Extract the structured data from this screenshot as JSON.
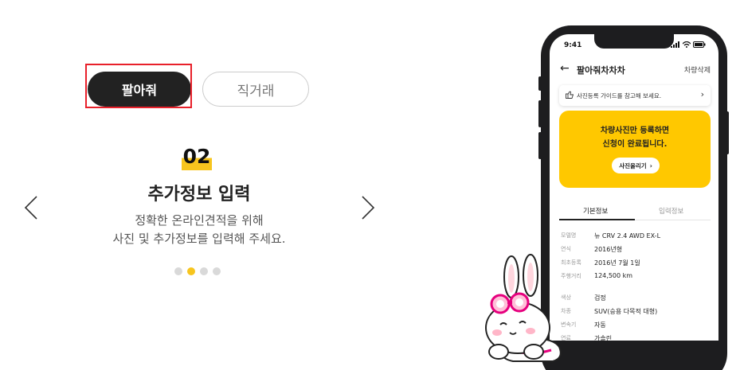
{
  "tabs": {
    "sell_label": "팔아줘",
    "direct_label": "직거래"
  },
  "step": {
    "number": "02",
    "title": "추가정보 입력",
    "desc_line1": "정확한 온라인견적을 위해",
    "desc_line2": "사진 및 추가정보를 입력해 주세요."
  },
  "pagination": {
    "total": 4,
    "active_index": 1
  },
  "colors": {
    "accent": "#ffc800",
    "highlight_border": "#e8202a",
    "dark": "#222222"
  },
  "phone": {
    "time": "9:41",
    "header_title": "팔아줘차차차",
    "header_action": "차량삭제",
    "guide_text": "사진등록 가이드를 참고해 보세요.",
    "card_line1": "차량사진만 등록하면",
    "card_line2": "신청이 완료됩니다.",
    "upload_button": "사진올리기",
    "tab_basic": "기본정보",
    "tab_input": "입력정보",
    "rows": [
      {
        "label": "모델명",
        "value": "뉴 CRV 2.4 AWD EX-L"
      },
      {
        "label": "연식",
        "value": "2016년형"
      },
      {
        "label": "최초등록",
        "value": "2016년 7월 1일"
      },
      {
        "label": "주행거리",
        "value": "124,500 km"
      },
      {
        "label": "색상",
        "value": "검정"
      },
      {
        "label": "차종",
        "value": "SUV(승용 다목적 대형)"
      },
      {
        "label": "변속기",
        "value": "자동"
      },
      {
        "label": "연료",
        "value": "가솔린"
      }
    ]
  }
}
